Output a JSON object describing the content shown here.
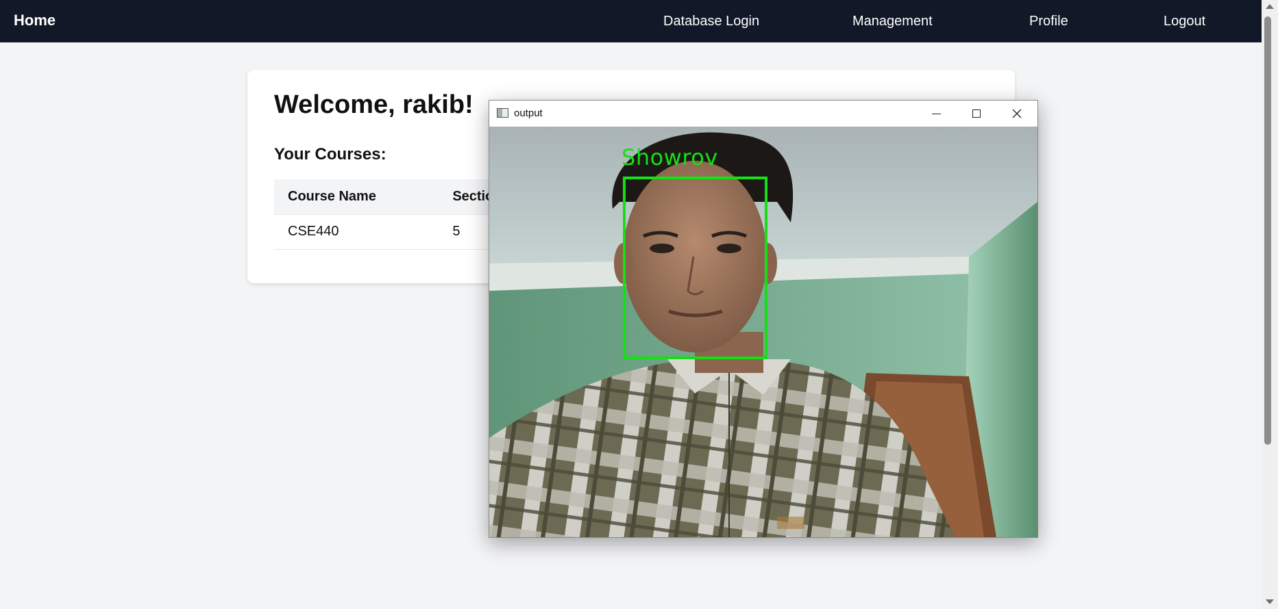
{
  "nav": {
    "home": "Home",
    "links": [
      "Database Login",
      "Management",
      "Profile",
      "Logout"
    ]
  },
  "card": {
    "welcome": "Welcome, rakib!",
    "courses_title": "Your Courses:",
    "table": {
      "headers": [
        "Course Name",
        "Section"
      ],
      "rows": [
        [
          "CSE440",
          "5"
        ]
      ]
    }
  },
  "output_window": {
    "title": "output",
    "controls": [
      "minimize-icon",
      "maximize-icon",
      "close-icon"
    ],
    "detection_label": "Showrov",
    "box_color": "#15e015"
  },
  "colors": {
    "navbar": "#111827",
    "background": "#f3f4f6"
  }
}
